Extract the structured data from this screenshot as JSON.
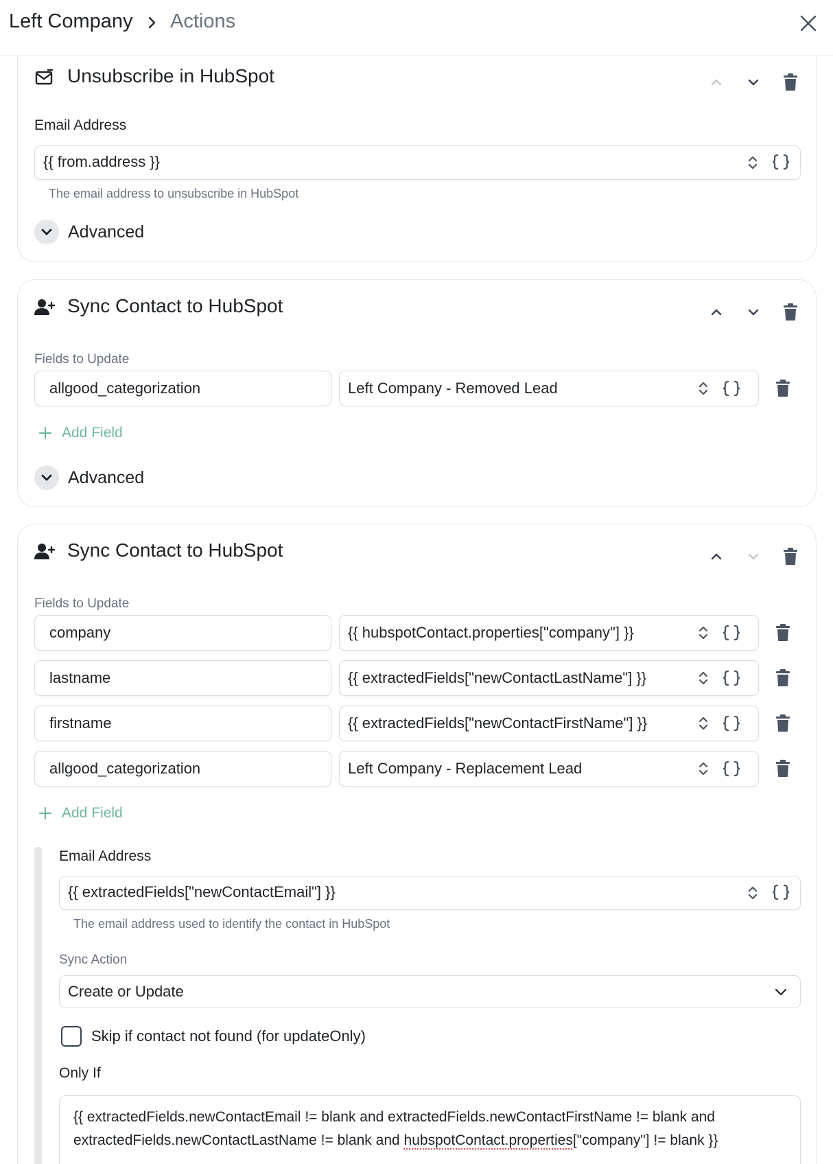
{
  "header": {
    "root": "Left Company",
    "current": "Actions"
  },
  "cards": [
    {
      "title": "Unsubscribe in HubSpot",
      "icon": "mail-minus-icon",
      "email_label": "Email Address",
      "email_value": "{{ from.address }}",
      "email_help": "The email address to unsubscribe in HubSpot",
      "advanced_label": "Advanced"
    },
    {
      "title": "Sync Contact to HubSpot",
      "icon": "user-plus-icon",
      "fields_label": "Fields to Update",
      "fields": [
        {
          "key": "allgood_categorization",
          "value": "Left Company - Removed Lead"
        }
      ],
      "add_field_label": "Add Field",
      "advanced_label": "Advanced"
    },
    {
      "title": "Sync Contact to HubSpot",
      "icon": "user-plus-icon",
      "fields_label": "Fields to Update",
      "fields": [
        {
          "key": "company",
          "value": "{{ hubspotContact.properties[\"company\"] }}"
        },
        {
          "key": "lastname",
          "value": "{{ extractedFields[\"newContactLastName\"] }}"
        },
        {
          "key": "firstname",
          "value": "{{ extractedFields[\"newContactFirstName\"] }}"
        },
        {
          "key": "allgood_categorization",
          "value": "Left Company - Replacement Lead"
        }
      ],
      "add_field_label": "Add Field",
      "email_label": "Email Address",
      "email_value": "{{ extractedFields[\"newContactEmail\"] }}",
      "email_help": "The email address used to identify the contact in HubSpot",
      "sync_action_label": "Sync Action",
      "sync_action_value": "Create or Update",
      "skip_label": "Skip if contact not found (for updateOnly)",
      "only_if_label": "Only If",
      "only_if_line1": "{{ extractedFields.newContactEmail != blank and extractedFields.newContactFirstName != blank and",
      "only_if_line2a": "extractedFields.newContactLastName != blank and ",
      "only_if_line2b": "hubspotContact.properties",
      "only_if_line2c": "[\"company\"] != blank }}"
    }
  ],
  "colors": {
    "accent_green": "#6fb89a",
    "border": "#d9dce1",
    "muted": "#6b7280"
  }
}
